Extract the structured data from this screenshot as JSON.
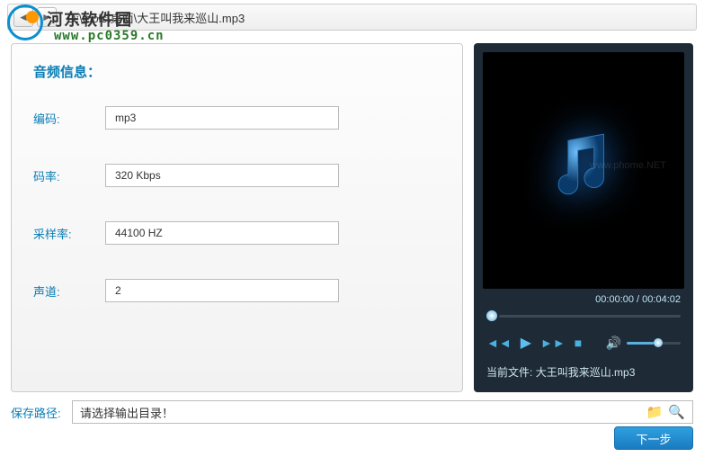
{
  "watermark": {
    "brand_cn": "河东软件园",
    "url": "www.pc0359.cn"
  },
  "topbar": {
    "path": "D:\\tools\\桌面\\大王叫我来巡山.mp3"
  },
  "info": {
    "title": "音频信息：",
    "rows": {
      "codec": {
        "label": "编码:",
        "value": "mp3"
      },
      "bitrate": {
        "label": "码率:",
        "value": "320 Kbps"
      },
      "samplerate": {
        "label": "采样率:",
        "value": "44100 HZ"
      },
      "channels": {
        "label": "声道:",
        "value": "2"
      }
    }
  },
  "player": {
    "preview_watermark": "www.phome.NET",
    "time_current": "00:00:00",
    "time_total": "00:04:02",
    "current_file_label": "当前文件:",
    "current_file_name": "大王叫我来巡山.mp3"
  },
  "save": {
    "label": "保存路径:",
    "placeholder": "请选择输出目录！"
  },
  "buttons": {
    "next": "下一步"
  },
  "colors": {
    "accent": "#0a7db5",
    "player_bg": "#1e2a36",
    "control": "#4bb0e0"
  }
}
